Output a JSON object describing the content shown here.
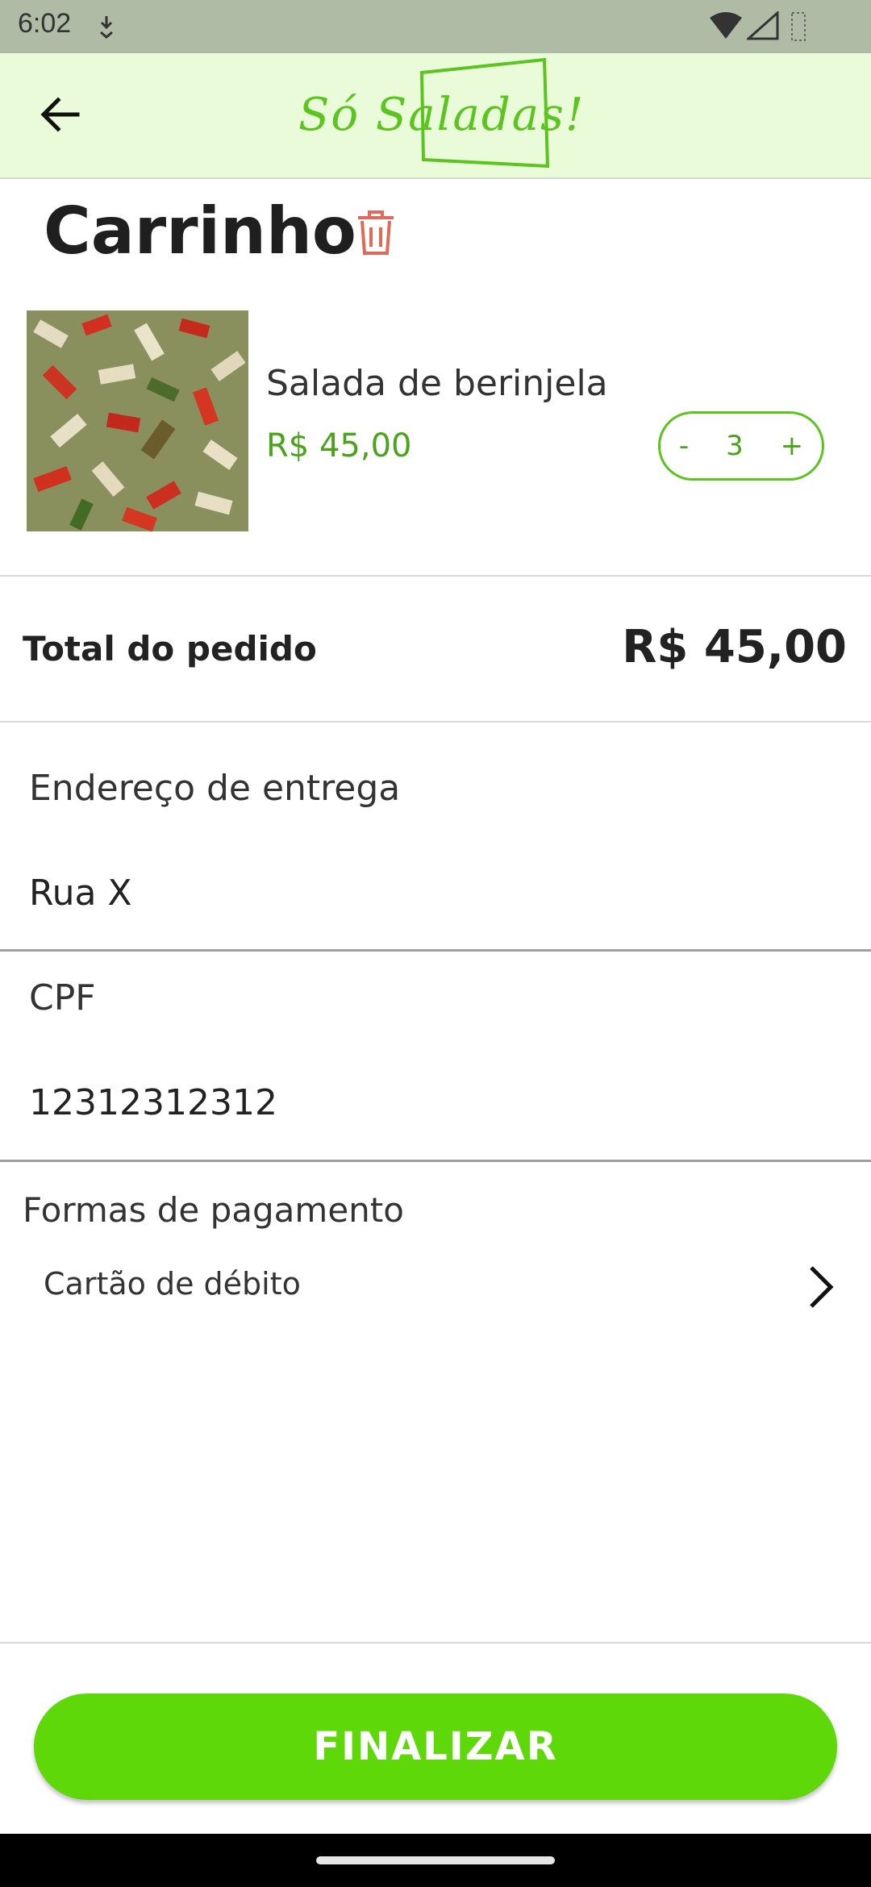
{
  "status_bar": {
    "time": "6:02"
  },
  "app_bar": {
    "logo_text": "Só Saladas!"
  },
  "cart": {
    "title": "Carrinho",
    "item": {
      "name": "Salada de berinjela",
      "price": "R$ 45,00",
      "quantity": "3",
      "decrement": "-",
      "increment": "+"
    }
  },
  "total": {
    "label": "Total do pedido",
    "value": "R$ 45,00"
  },
  "address": {
    "label": "Endereço de entrega",
    "value": "Rua X"
  },
  "cpf": {
    "label": "CPF",
    "value": "12312312312"
  },
  "payment": {
    "label": "Formas de pagamento",
    "selected": "Cartão de débito"
  },
  "finalize_label": "FINALIZAR",
  "colors": {
    "accent": "#5fd80a",
    "appbar_bg": "#e9fbd9",
    "price_green": "#4aa31a",
    "trash_red": "#e06a5a"
  }
}
